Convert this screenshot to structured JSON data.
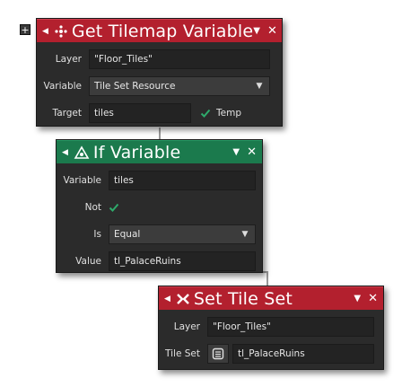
{
  "plus_button": {
    "label": "+"
  },
  "node1": {
    "title": "Get Tilemap Variable",
    "collapse_arrow": "◀",
    "dropdown_arrow": "▼",
    "close": "✕",
    "icon": "tilemap-icon",
    "rows": {
      "layer_label": "Layer",
      "layer_value": "\"Floor_Tiles\"",
      "variable_label": "Variable",
      "variable_value": "Tile Set Resource",
      "target_label": "Target",
      "target_value": "tiles",
      "temp_label": "Temp"
    },
    "temp_checked": true,
    "header_color": "#b3202e"
  },
  "node2": {
    "title": "If Variable",
    "collapse_arrow": "◀",
    "dropdown_arrow": "▼",
    "close": "✕",
    "icon": "if-variable-icon",
    "rows": {
      "variable_label": "Variable",
      "variable_value": "tiles",
      "not_label": "Not",
      "is_label": "Is",
      "is_value": "Equal",
      "value_label": "Value",
      "value_value": "tl_PalaceRuins"
    },
    "not_checked": true,
    "header_color": "#1b7a4d"
  },
  "node3": {
    "title": "Set Tile Set",
    "collapse_arrow": "◀",
    "dropdown_arrow": "▼",
    "close": "✕",
    "icon": "tileset-icon",
    "rows": {
      "layer_label": "Layer",
      "layer_value": "\"Floor_Tiles\"",
      "tileset_label": "Tile Set",
      "tileset_value": "tl_PalaceRuins"
    },
    "header_color": "#b3202e"
  }
}
